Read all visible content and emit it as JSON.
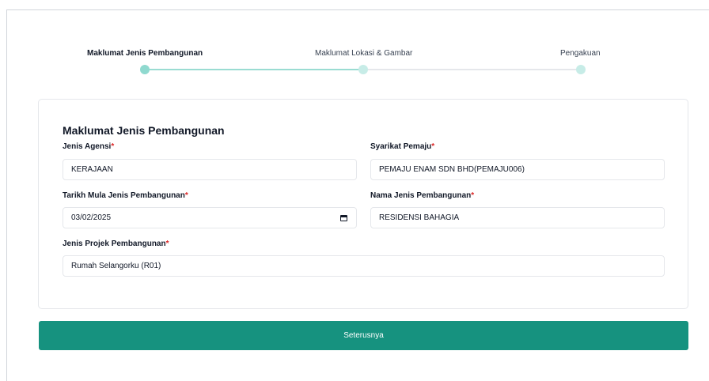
{
  "stepper": {
    "steps": [
      {
        "label": "Maklumat Jenis Pembangunan",
        "active": true
      },
      {
        "label": "Maklumat Lokasi & Gambar",
        "active": false
      },
      {
        "label": "Pengakuan",
        "active": false
      }
    ]
  },
  "form": {
    "title": "Maklumat Jenis Pembangunan",
    "required_mark": "*",
    "fields": {
      "jenis_agensi": {
        "label": "Jenis Agensi",
        "value": "KERAJAAN"
      },
      "syarikat_pemaju": {
        "label": "Syarikat Pemaju",
        "value": "PEMAJU ENAM SDN BHD(PEMAJU006)"
      },
      "tarikh_mula": {
        "label": "Tarikh Mula Jenis Pembangunan",
        "value": "03/02/2025"
      },
      "nama_jenis": {
        "label": "Nama Jenis Pembangunan",
        "value": "RESIDENSI BAHAGIA"
      },
      "jenis_projek": {
        "label": "Jenis Projek Pembangunan",
        "value": "Rumah Selangorku (R01)"
      }
    }
  },
  "actions": {
    "next_label": "Seterusnya"
  },
  "colors": {
    "primary": "#16927f",
    "required": "#dc2626",
    "step_active": "#8fd9cf",
    "step_inactive": "#c7ece7"
  }
}
